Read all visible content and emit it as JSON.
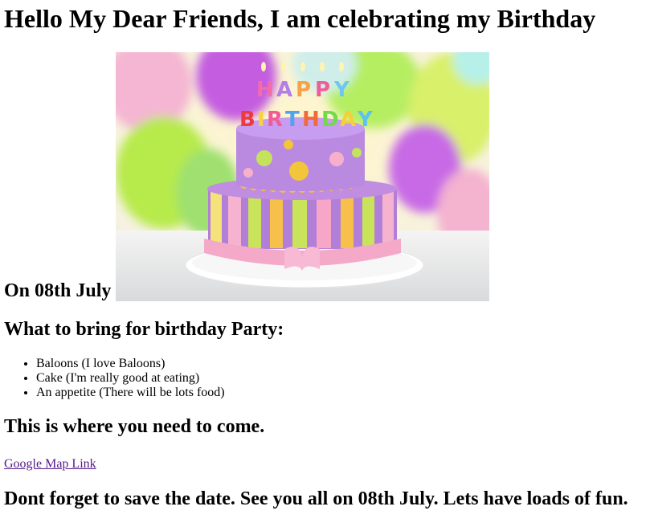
{
  "title": "Hello My Dear Friends, I am celebrating my Birthday",
  "date_label": "On 08th July",
  "image": {
    "subject": "birthday-cake-icon",
    "lettering": "HAPPY BIRTHDAY"
  },
  "bring_heading": "What to bring for birthday Party:",
  "bring_items": [
    "Baloons (I love Baloons)",
    "Cake (I'm really good at eating)",
    "An appetite (There will be lots food)"
  ],
  "location_heading": "This is where you need to come.",
  "map_link_label": "Google Map Link",
  "closing": "Dont forget to save the date. See you all on 08th July. Lets have loads of fun.",
  "colors": {
    "link_visited": "#551a8b",
    "text": "#000000",
    "background": "#ffffff"
  }
}
